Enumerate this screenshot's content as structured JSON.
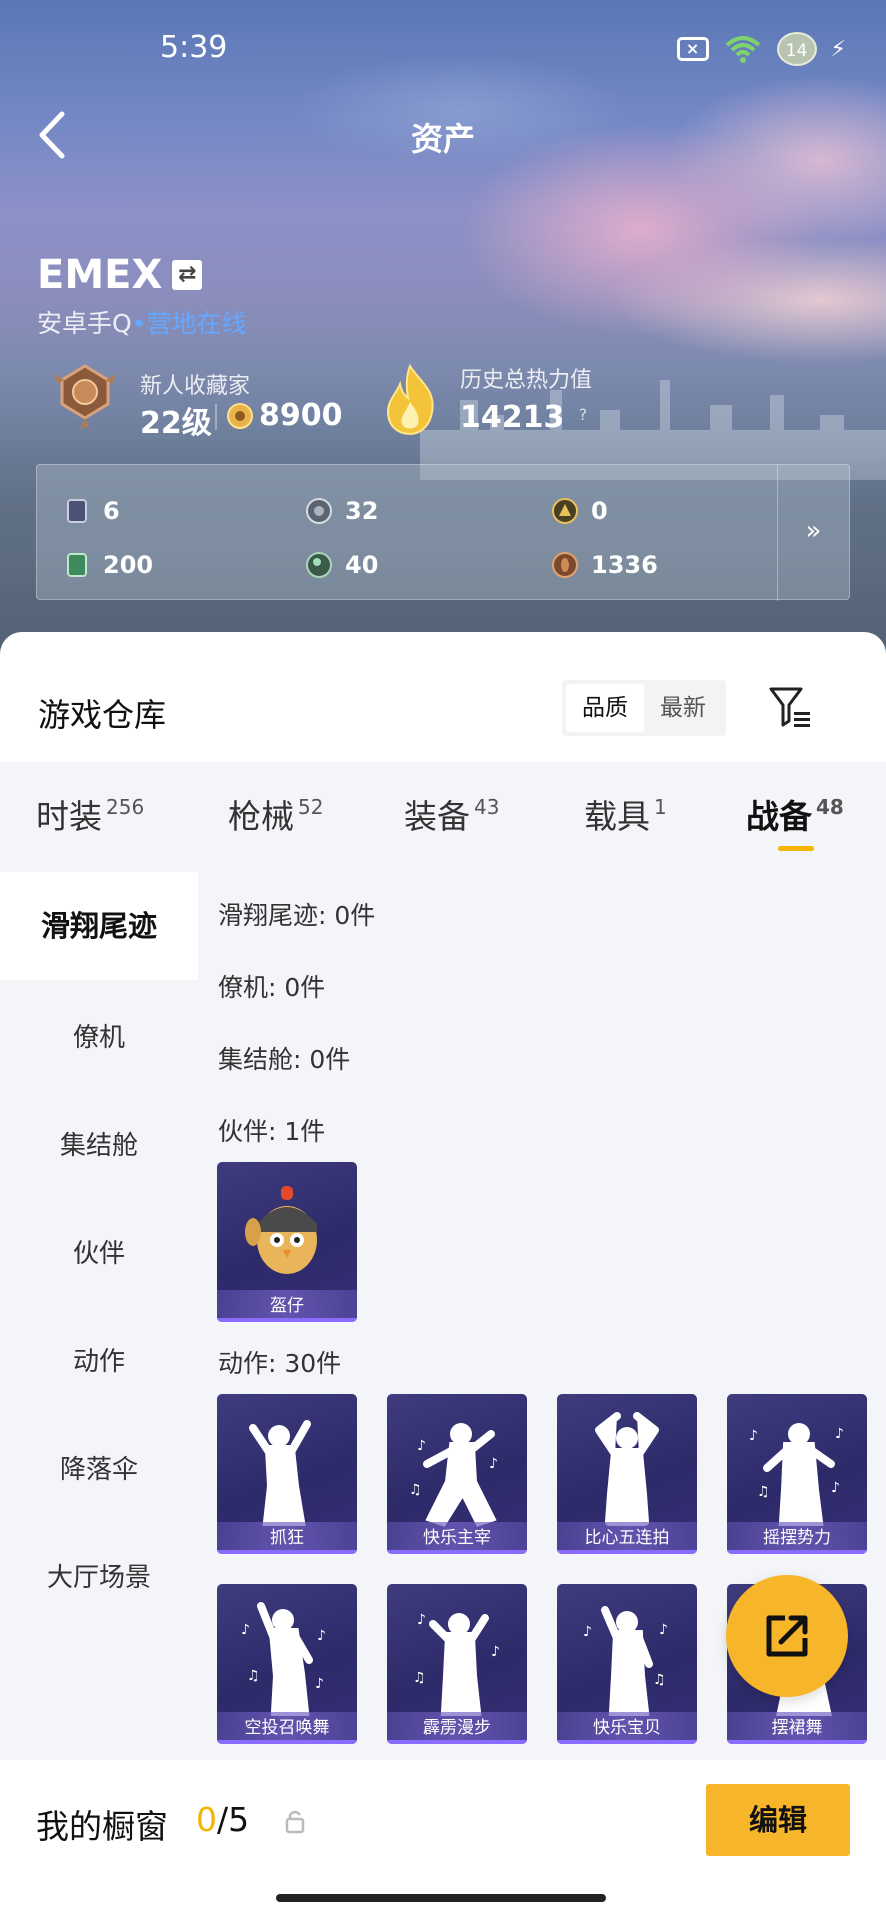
{
  "status_bar": {
    "time": "5:39",
    "battery": "14",
    "x_badge": "×"
  },
  "nav": {
    "title": "资产"
  },
  "profile": {
    "name": "EMEX",
    "swap_glyph": "⇄",
    "platform": "安卓手Q",
    "online_dot": "•",
    "status": "营地在线",
    "rank_title": "新人收藏家",
    "level": "22级",
    "coins": "8900",
    "heat_title": "历史总热力值",
    "heat_value": "14213",
    "heat_help": "?"
  },
  "currencies": [
    {
      "value": "6",
      "icon": "card-icon"
    },
    {
      "value": "32",
      "icon": "silver-coin-icon"
    },
    {
      "value": "0",
      "icon": "gold-badge-icon"
    },
    {
      "value": "200",
      "icon": "ticket-icon"
    },
    {
      "value": "40",
      "icon": "green-orb-icon"
    },
    {
      "value": "1336",
      "icon": "bronze-coin-icon"
    }
  ],
  "currency_more": "»",
  "warehouse": {
    "title": "游戏仓库",
    "sort_options": [
      "品质",
      "最新"
    ],
    "tabs": [
      {
        "label": "时装",
        "count": "256"
      },
      {
        "label": "枪械",
        "count": "52"
      },
      {
        "label": "装备",
        "count": "43"
      },
      {
        "label": "载具",
        "count": "1"
      },
      {
        "label": "战备",
        "count": "48"
      }
    ],
    "sidebar": [
      "滑翔尾迹",
      "僚机",
      "集结舱",
      "伙伴",
      "动作",
      "降落伞",
      "大厅场景"
    ],
    "sections": [
      "滑翔尾迹: 0件",
      "僚机: 0件",
      "集结舱: 0件",
      "伙伴: 1件",
      "动作: 30件"
    ],
    "partner_items": [
      "盔仔"
    ],
    "emote_items": [
      "抓狂",
      "快乐主宰",
      "比心五连拍",
      "摇摆势力",
      "空投召唤舞",
      "霹雳漫步",
      "快乐宝贝",
      "摆裙舞"
    ]
  },
  "showcase": {
    "title": "我的橱窗",
    "current": "0",
    "sep_total": "/5",
    "edit": "编辑"
  },
  "colors": {
    "accent": "#f5b400",
    "button": "#f7b52a",
    "card": "#2d2a6a",
    "online": "#62a9ff"
  }
}
